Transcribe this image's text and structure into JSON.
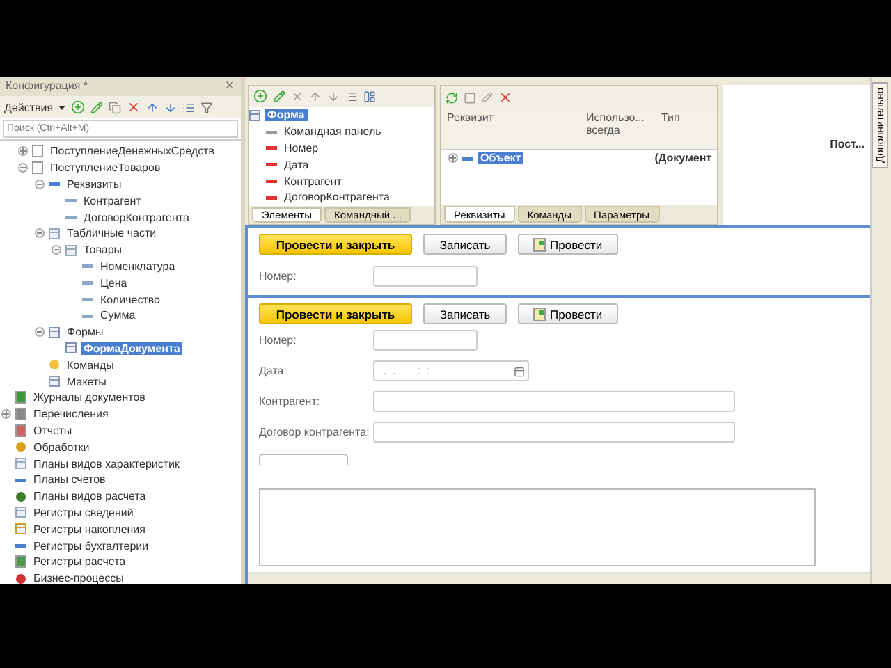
{
  "config_panel": {
    "title": "Конфигурация *",
    "actions_label": "Действия",
    "search": {
      "placeholder": "Поиск (Ctrl+Alt+M)"
    },
    "continued_items": [
      {
        "label": "ПоступлениеДенежныхСредств",
        "kind": "document",
        "expanded": false,
        "selected": false
      },
      {
        "label": "ПоступлениеТоваров",
        "kind": "document",
        "expanded": true,
        "selected": false,
        "children": [
          {
            "label": "Реквизиты",
            "kind": "attribute",
            "expanded": true,
            "selected": false,
            "children": [
              {
                "label": "Контрагент",
                "kind": "field",
                "selected": false
              },
              {
                "label": "ДоговорКонтрагента",
                "kind": "field",
                "selected": false
              }
            ]
          },
          {
            "label": "Табличные части",
            "kind": "table",
            "expanded": true,
            "selected": false,
            "children": [
              {
                "label": "Товары",
                "kind": "table",
                "expanded": true,
                "selected": false,
                "children": [
                  {
                    "label": "Номенклатура",
                    "kind": "field",
                    "selected": false
                  },
                  {
                    "label": "Цена",
                    "kind": "field",
                    "selected": false
                  },
                  {
                    "label": "Количество",
                    "kind": "field",
                    "selected": false
                  },
                  {
                    "label": "Сумма",
                    "kind": "field",
                    "selected": false
                  }
                ]
              }
            ]
          },
          {
            "label": "Формы",
            "kind": "form",
            "expanded": true,
            "selected": false,
            "children": [
              {
                "label": "ФормаДокумента",
                "kind": "form",
                "selected": true
              }
            ]
          },
          {
            "label": "Команды",
            "kind": "commands",
            "selected": false
          },
          {
            "label": "Макеты",
            "kind": "templates",
            "selected": false
          }
        ]
      }
    ],
    "items": [
      {
        "label": "Журналы документов",
        "kind": "journal",
        "selected": false
      },
      {
        "label": "Перечисления",
        "kind": "enum",
        "expanded": false,
        "selected": false
      },
      {
        "label": "Отчеты",
        "kind": "report",
        "selected": false
      },
      {
        "label": "Обработки",
        "kind": "processing",
        "selected": false
      },
      {
        "label": "Планы видов характеристик",
        "kind": "table",
        "selected": false
      },
      {
        "label": "Планы счетов",
        "kind": "accounts",
        "selected": false
      },
      {
        "label": "Планы видов расчета",
        "kind": "calc",
        "selected": false
      },
      {
        "label": "Регистры сведений",
        "kind": "table",
        "selected": false
      },
      {
        "label": "Регистры накопления",
        "kind": "accum",
        "selected": false
      },
      {
        "label": "Регистры бухгалтерии",
        "kind": "accounts",
        "selected": false
      },
      {
        "label": "Регистры расчета",
        "kind": "calcreg",
        "selected": false
      },
      {
        "label": "Бизнес-процессы",
        "kind": "process",
        "selected": false
      }
    ]
  },
  "elements_panel": {
    "tree": [
      {
        "label": "Форма",
        "kind": "form",
        "selected": true,
        "children": [
          {
            "label": "Командная панель",
            "kind": "panel",
            "selected": false
          },
          {
            "label": "Номер",
            "kind": "element",
            "selected": false
          },
          {
            "label": "Дата",
            "kind": "element",
            "selected": false
          },
          {
            "label": "Контрагент",
            "kind": "element",
            "selected": false
          },
          {
            "label": "ДоговорКонтрагента",
            "kind": "element",
            "selected": false
          }
        ]
      }
    ],
    "tabs": [
      {
        "label": "Элементы",
        "selected": true
      },
      {
        "label": "Командный ...",
        "selected": false
      }
    ]
  },
  "attributes_panel": {
    "columns": [
      "Реквизит",
      "Использо... всегда",
      "Тип"
    ],
    "rows": [
      {
        "name": "Объект",
        "type": "(Документ",
        "type_tail": "Пост...",
        "expanded": false,
        "selected": true
      }
    ],
    "tabs": [
      {
        "label": "Реквизиты",
        "selected": true
      },
      {
        "label": "Команды",
        "selected": false
      },
      {
        "label": "Параметры",
        "selected": false
      }
    ]
  },
  "form_strip": {
    "buttons": [
      {
        "label": "Провести и закрыть",
        "kind": "default"
      },
      {
        "label": "Записать",
        "kind": "plain"
      },
      {
        "label": "Провести",
        "kind": "post"
      }
    ],
    "fields": [
      {
        "label": "Номер:",
        "kind": "short"
      }
    ]
  },
  "form": {
    "buttons": [
      {
        "label": "Провести и закрыть",
        "kind": "default"
      },
      {
        "label": "Записать",
        "kind": "plain"
      },
      {
        "label": "Провести",
        "kind": "post"
      }
    ],
    "fields": [
      {
        "label": "Номер:",
        "kind": "short"
      },
      {
        "label": "Дата:",
        "kind": "date",
        "value": "  .  .       :  :  "
      },
      {
        "label": "Контрагент:",
        "kind": "wide"
      },
      {
        "label": "Договор контрагента:",
        "kind": "wide"
      }
    ]
  },
  "side_tab": {
    "label": "Дополнительно"
  }
}
